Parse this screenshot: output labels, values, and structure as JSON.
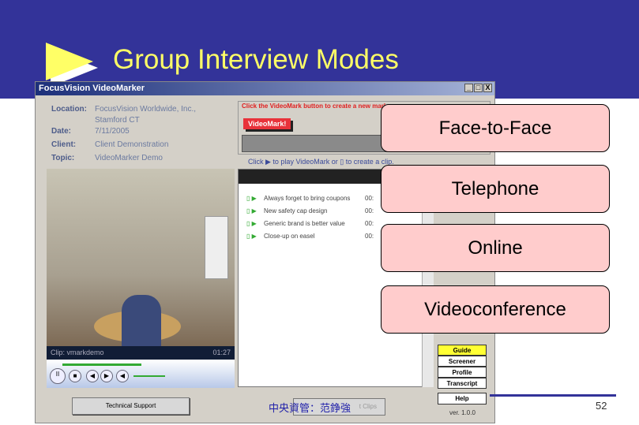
{
  "slide": {
    "title": "Group Interview Modes",
    "page_number": "52",
    "author": "中央資管：范錚強",
    "accent": "#333399",
    "title_color": "#ffff66"
  },
  "window": {
    "title": "FocusVision VideoMarker",
    "info": [
      {
        "key": "Location:",
        "value": "FocusVision Worldwide, Inc., Stamford CT"
      },
      {
        "key": "Date:",
        "value": "7/11/2005"
      },
      {
        "key": "Client:",
        "value": "Client Demonstration"
      },
      {
        "key": "Topic:",
        "value": "VideoMarker Demo"
      }
    ],
    "mark_label": "Click the VideoMark button to create a new mark",
    "videomark_button": "VideoMark!",
    "hint": "Click ▶ to play VideoMark or ▯ to create a clip.",
    "clip_name": "Clip: vmarkdemo",
    "clip_time": "01:27",
    "marks": [
      {
        "text": "Always forget to bring coupons",
        "time": "00:"
      },
      {
        "text": "New safety cap design",
        "time": "00:"
      },
      {
        "text": "Generic brand is better value",
        "time": "00:"
      },
      {
        "text": "Close-up on easel",
        "time": "00:"
      }
    ],
    "side_buttons": [
      "Guide",
      "Screener",
      "Profile",
      "Transcript"
    ],
    "help": "Help",
    "version": "ver. 1.0.0",
    "tech_support": "Technical Support",
    "clips_button": "t Clips"
  },
  "modes": [
    "Face-to-Face",
    "Telephone",
    "Online",
    "Videoconference"
  ]
}
